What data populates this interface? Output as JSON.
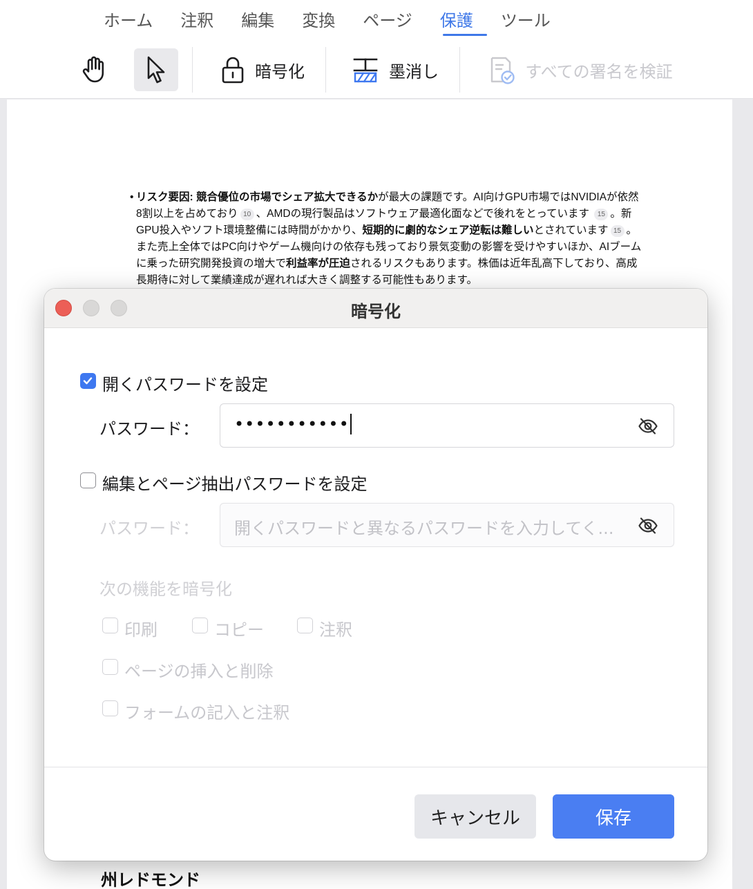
{
  "menu_tabs": [
    {
      "label": "ホーム"
    },
    {
      "label": "注釈"
    },
    {
      "label": "編集"
    },
    {
      "label": "変換"
    },
    {
      "label": "ページ"
    },
    {
      "label": "保護"
    },
    {
      "label": "ツール"
    }
  ],
  "toolbar": {
    "hand_icon": "hand-icon",
    "select_icon": "cursor-arrow-icon",
    "encrypt_label": "暗号化",
    "redact_label": "墨消し",
    "verify_label": "すべての署名を検証"
  },
  "document": {
    "paragraph": {
      "p1_bold": "リスク要因: 競合優位の市場でシェア拡大できるか",
      "p1": "が最大の課題です。AI向けGPU市場ではNVIDIAが依然8割以上を占めており",
      "cite1": "10",
      "p2": "、AMDの現行製品はソフトウェア最適化面などで後れをとっています",
      "cite2": "15",
      "p3": "。新GPU投入やソフト環境整備には時間がかかり、",
      "p3_bold": "短期的に劇的なシェア逆転は難しい",
      "p4": "とされています",
      "cite3": "15",
      "p5": "。また売上全体ではPC向けやゲーム機向けの依存も残っており景気変動の影響を受けやすいほか、AIブームに乗った研究開発投資の増大で",
      "p5_bold": "利益率が圧迫",
      "p6": "されるリスクもあります。株価は近年乱高下しており、高成長期待に対して業績達成が遅れれば大きく調整する可能性もあります。"
    },
    "footer_fragment": "州レドモンド"
  },
  "dialog": {
    "title": "暗号化",
    "open_password": {
      "checkbox_label": "開くパスワードを設定",
      "checked": true,
      "field_label": "パスワード：",
      "value": "•••••••••••"
    },
    "edit_password": {
      "checkbox_label": "編集とページ抽出パスワードを設定",
      "checked": false,
      "field_label": "パスワード：",
      "placeholder": "開くパスワードと異なるパスワードを入力してく..."
    },
    "encrypt_features": {
      "section_label": "次の機能を暗号化",
      "options": [
        {
          "label": "印刷"
        },
        {
          "label": "コピー"
        },
        {
          "label": "注釈"
        },
        {
          "label": "ページの挿入と削除"
        },
        {
          "label": "フォームの記入と注釈"
        }
      ]
    },
    "buttons": {
      "cancel": "キャンセル",
      "save": "保存"
    }
  },
  "colors": {
    "accent": "#3f78e8",
    "save_button": "#4a7ef2",
    "close_traffic_light": "#ec5f57"
  }
}
